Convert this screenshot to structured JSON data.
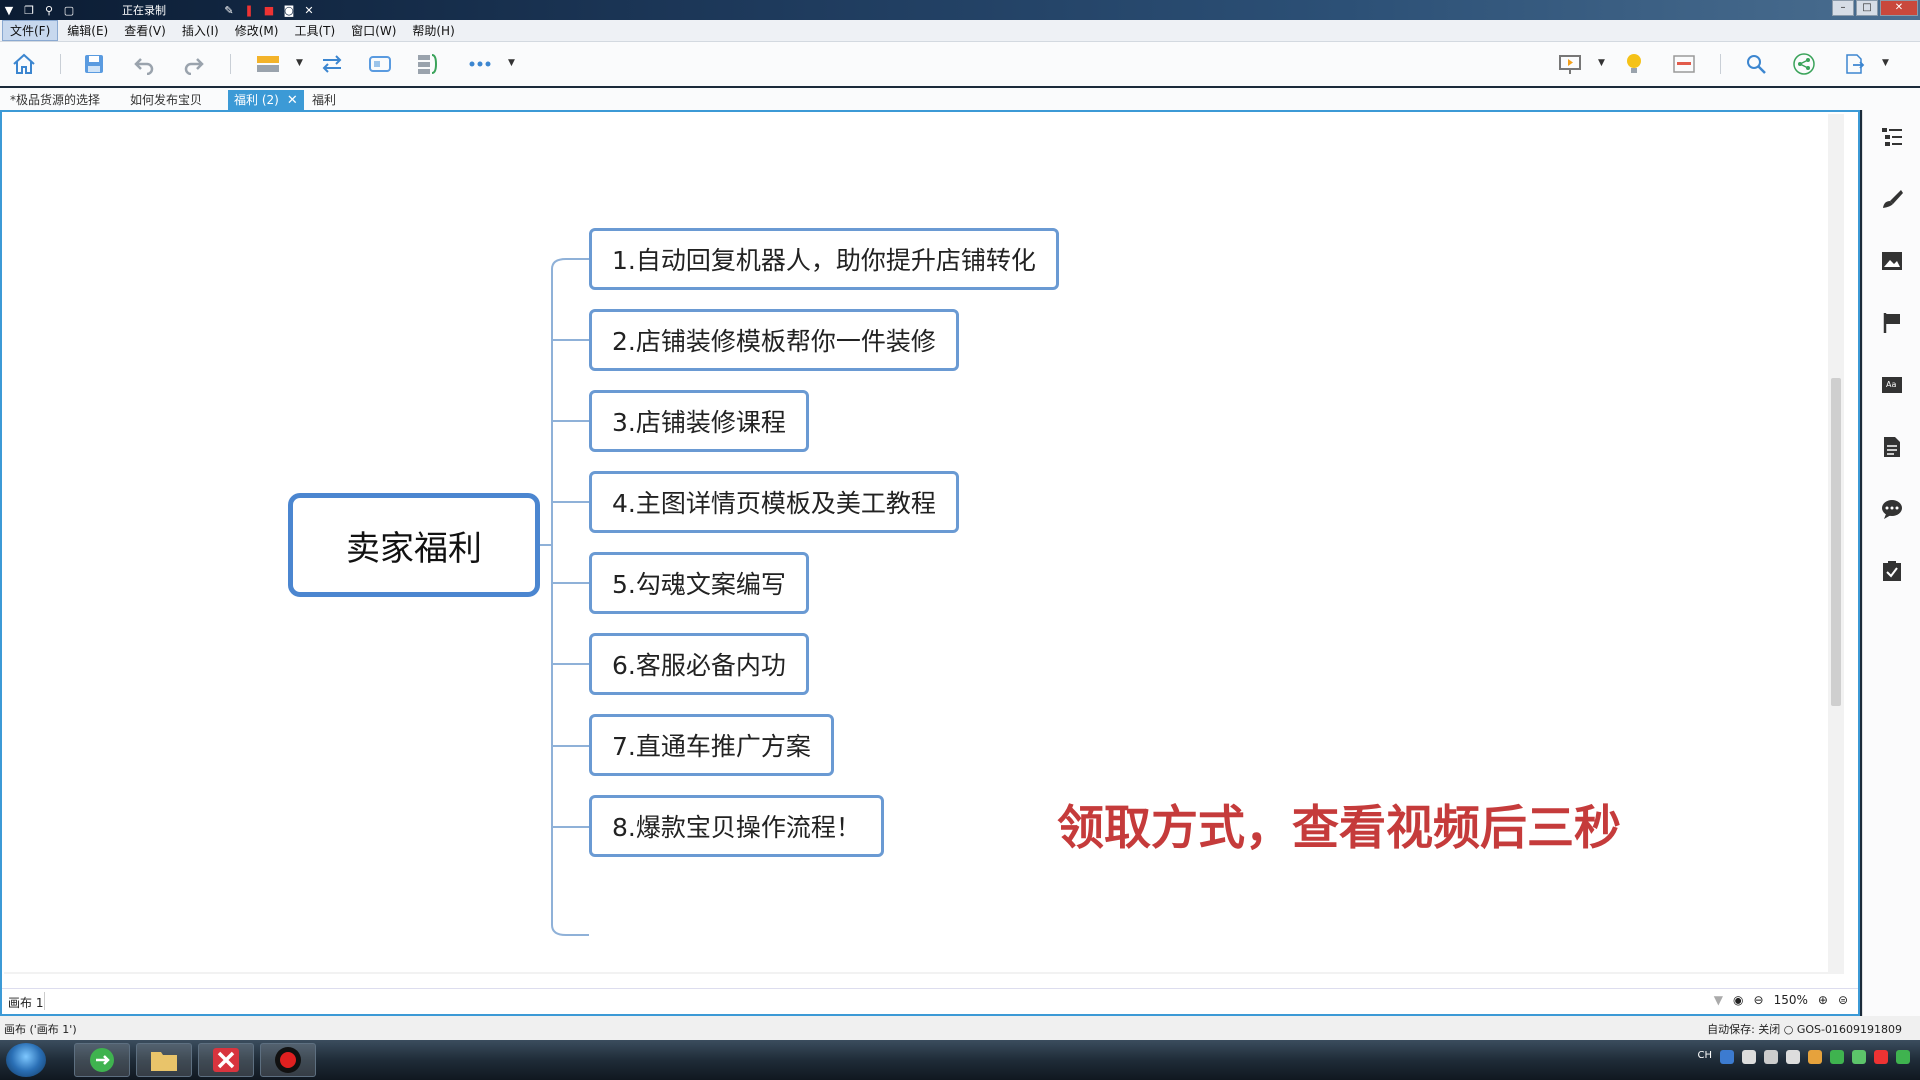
{
  "recorder": {
    "status": "正在录制"
  },
  "menu": [
    "文件(F)",
    "编辑(E)",
    "查看(V)",
    "插入(I)",
    "修改(M)",
    "工具(T)",
    "窗口(W)",
    "帮助(H)"
  ],
  "tabs": [
    {
      "label": "*极品货源的选择"
    },
    {
      "label": "如何发布宝贝"
    },
    {
      "label": "福利 (2)"
    },
    {
      "label": "福利"
    }
  ],
  "mindmap": {
    "root": "卖家福利",
    "topics": [
      "1.自动回复机器人，助你提升店铺转化",
      "2.店铺装修模板帮你一件装修",
      "3.店铺装修课程",
      "4.主图详情页模板及美工教程",
      "5.勾魂文案编写",
      "6.客服必备内功",
      "7.直通车推广方案",
      "8.爆款宝贝操作流程！"
    ],
    "callout": "领取方式，查看视频后三秒"
  },
  "canvas_status": {
    "sheet": "画布 1",
    "zoom": "150%"
  },
  "app_status": {
    "left": "画布 ('画布 1')",
    "right": "自动保存: 关闭  ○ GOS-01609191809"
  },
  "taskbar": {
    "lang": "CH"
  },
  "colors": {
    "accent": "#3c9ad6",
    "node_border": "#6a9ad3",
    "root_border": "#4b86d0",
    "callout": "#c53b3b"
  }
}
